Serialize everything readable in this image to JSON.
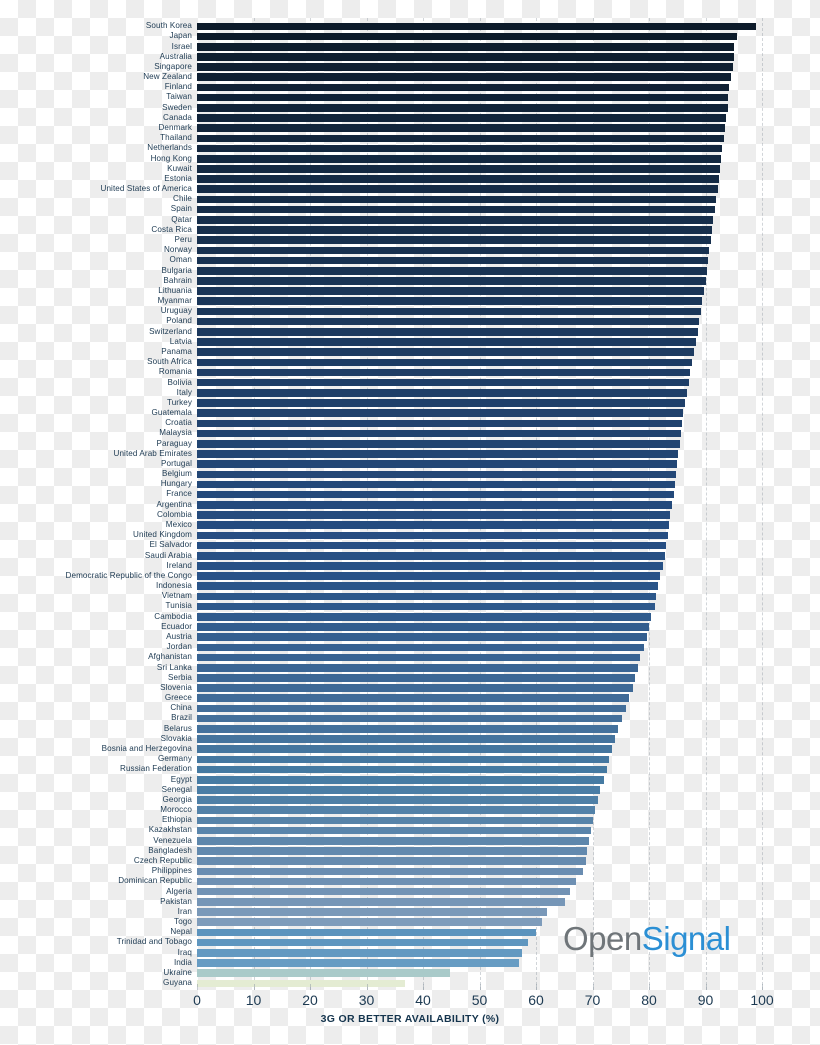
{
  "branding": {
    "logo_open": "Open",
    "logo_signal": "Signal",
    "color_logo_open": "#6f7579",
    "color_logo_signal": "#2b8fd4"
  },
  "axis": {
    "title": "3G OR BETTER AVAILABILITY (%)",
    "ticks": [
      "0",
      "10",
      "20",
      "30",
      "40",
      "50",
      "60",
      "70",
      "80",
      "90",
      "100"
    ],
    "label_color": "#1d3a52"
  },
  "chart_data": {
    "type": "bar",
    "orientation": "horizontal",
    "title": "",
    "subtitle": "",
    "xlabel": "3G OR BETTER AVAILABILITY (%)",
    "ylabel": "",
    "xlim": [
      0,
      100
    ],
    "tick_step": 10,
    "grid": true,
    "grid_style": "dashed-vertical",
    "legend": "none",
    "colormap": "navy-to-pale-green (descending value gradient)",
    "categories": [
      "South Korea",
      "Japan",
      "Israel",
      "Australia",
      "Singapore",
      "New Zealand",
      "Finland",
      "Taiwan",
      "Sweden",
      "Canada",
      "Denmark",
      "Thailand",
      "Netherlands",
      "Hong Kong",
      "Kuwait",
      "Estonia",
      "United States of America",
      "Chile",
      "Spain",
      "Qatar",
      "Costa Rica",
      "Peru",
      "Norway",
      "Oman",
      "Bulgaria",
      "Bahrain",
      "Lithuania",
      "Myanmar",
      "Uruguay",
      "Poland",
      "Switzerland",
      "Latvia",
      "Panama",
      "South Africa",
      "Romania",
      "Bolivia",
      "Italy",
      "Turkey",
      "Guatemala",
      "Croatia",
      "Malaysia",
      "Paraguay",
      "United Arab Emirates",
      "Portugal",
      "Belgium",
      "Hungary",
      "France",
      "Argentina",
      "Colombia",
      "Mexico",
      "United Kingdom",
      "El Salvador",
      "Saudi Arabia",
      "Ireland",
      "Democratic Republic of the Congo",
      "Indonesia",
      "Vietnam",
      "Tunisia",
      "Cambodia",
      "Ecuador",
      "Austria",
      "Jordan",
      "Afghanistan",
      "Sri Lanka",
      "Serbia",
      "Slovenia",
      "Greece",
      "China",
      "Brazil",
      "Belarus",
      "Slovakia",
      "Bosnia and Herzegovina",
      "Germany",
      "Russian Federation",
      "Egypt",
      "Senegal",
      "Georgia",
      "Morocco",
      "Ethiopia",
      "Kazakhstan",
      "Venezuela",
      "Bangladesh",
      "Czech Republic",
      "Philippines",
      "Dominican Republic",
      "Algeria",
      "Pakistan",
      "Iran",
      "Togo",
      "Nepal",
      "Trinidad and Tobago",
      "Iraq",
      "India",
      "Ukraine",
      "Guyana"
    ],
    "values": [
      99.0,
      95.5,
      95.0,
      95.0,
      94.8,
      94.6,
      94.2,
      94.0,
      93.9,
      93.7,
      93.5,
      93.3,
      93.0,
      92.8,
      92.6,
      92.4,
      92.2,
      91.8,
      91.6,
      91.4,
      91.2,
      91.0,
      90.6,
      90.4,
      90.2,
      90.0,
      89.8,
      89.4,
      89.2,
      88.9,
      88.6,
      88.3,
      88.0,
      87.6,
      87.3,
      87.0,
      86.7,
      86.4,
      86.1,
      85.9,
      85.7,
      85.5,
      85.2,
      85.0,
      84.8,
      84.6,
      84.4,
      84.0,
      83.8,
      83.6,
      83.3,
      83.0,
      82.8,
      82.5,
      82.0,
      81.6,
      81.3,
      81.0,
      80.4,
      80.0,
      79.6,
      79.2,
      78.4,
      78.0,
      77.6,
      77.2,
      76.5,
      76.0,
      75.3,
      74.6,
      74.0,
      73.4,
      73.0,
      72.6,
      72.0,
      71.4,
      70.9,
      70.4,
      70.0,
      69.7,
      69.4,
      69.1,
      68.8,
      68.4,
      67.0,
      66.0,
      65.2,
      62.0,
      61.0,
      60.0,
      58.6,
      57.6,
      57.0,
      44.8,
      36.8
    ],
    "bar_colors": [
      "#0d1b2a",
      "#0d1b2a",
      "#0e1d2d",
      "#0e1e2f",
      "#0f1f31",
      "#0f2033",
      "#102134",
      "#102236",
      "#112338",
      "#11243a",
      "#12253b",
      "#12263d",
      "#13273f",
      "#132840",
      "#142942",
      "#142a44",
      "#152b46",
      "#152c47",
      "#162d49",
      "#162e4b",
      "#172f4c",
      "#17304e",
      "#183150",
      "#183252",
      "#193353",
      "#193455",
      "#1a3557",
      "#1a3659",
      "#1b375a",
      "#1b385c",
      "#1c395e",
      "#1c3a60",
      "#1d3b61",
      "#1d3c63",
      "#1e3d65",
      "#1e3e67",
      "#1f3f68",
      "#1f406a",
      "#20416c",
      "#20426e",
      "#21436f",
      "#214471",
      "#224573",
      "#224675",
      "#234776",
      "#234878",
      "#24497a",
      "#244a7c",
      "#254b7d",
      "#254c7f",
      "#264d81",
      "#264e83",
      "#275084",
      "#275186",
      "#285288",
      "#2a5589",
      "#2c578a",
      "#2e598c",
      "#305b8d",
      "#325d8e",
      "#345f90",
      "#366191",
      "#386392",
      "#3a6594",
      "#3c6795",
      "#3e6996",
      "#406b98",
      "#426d99",
      "#446f9a",
      "#44719c",
      "#44739d",
      "#44759e",
      "#4477a0",
      "#4479a1",
      "#467ba3",
      "#4a7da5",
      "#4e7fa6",
      "#5281a8",
      "#5683a9",
      "#5a85ab",
      "#5e87ac",
      "#6289ae",
      "#668baf",
      "#6a8db1",
      "#6e90b3",
      "#7293b5",
      "#7696b7",
      "#7a99b9",
      "#7e9cbb",
      "#5b93bd",
      "#5f96bf",
      "#6399c1",
      "#679cc3",
      "#a9cac9",
      "#e4ecd3"
    ]
  }
}
